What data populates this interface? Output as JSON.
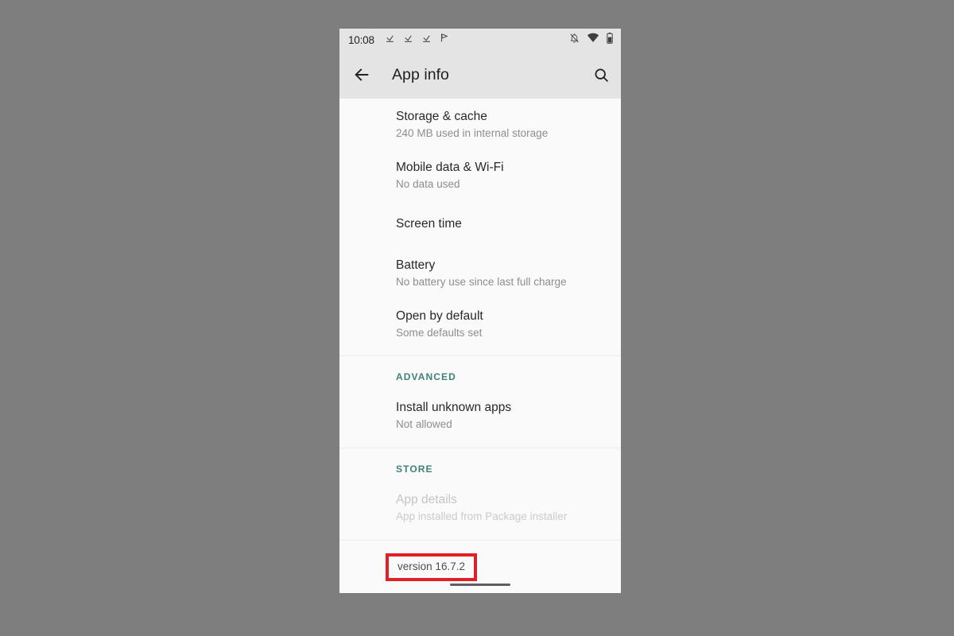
{
  "theme": {
    "page_background": "#7e7e7e",
    "screen_background": "#fafafa",
    "app_bar_background": "#e4e4e4",
    "section_header_color": "#3f8177",
    "highlight_color": "#e01f26",
    "primary_text_color": "#26282a",
    "secondary_text_color": "#8b8e91",
    "disabled_text_color": "#c3c5c7"
  },
  "status_bar": {
    "time": "10:08",
    "left_icons": [
      "download-arrow-icon",
      "download-arrow-icon",
      "download-arrow-icon",
      "flag-outline-icon"
    ],
    "right_icons": [
      "notifications-off-icon",
      "wifi-icon",
      "battery-icon"
    ]
  },
  "app_bar": {
    "back_icon": "back-arrow-icon",
    "title": "App info",
    "search_icon": "search-icon"
  },
  "sections": [
    {
      "header": null,
      "items": [
        {
          "primary": "Storage & cache",
          "secondary": "240 MB used in internal storage",
          "disabled": false
        },
        {
          "primary": "Mobile data & Wi-Fi",
          "secondary": "No data used",
          "disabled": false
        },
        {
          "primary": "Screen time",
          "secondary": null,
          "disabled": false
        },
        {
          "primary": "Battery",
          "secondary": "No battery use since last full charge",
          "disabled": false
        },
        {
          "primary": "Open by default",
          "secondary": "Some defaults set",
          "disabled": false
        }
      ]
    },
    {
      "header": "ADVANCED",
      "items": [
        {
          "primary": "Install unknown apps",
          "secondary": "Not allowed",
          "disabled": false
        }
      ]
    },
    {
      "header": "STORE",
      "items": [
        {
          "primary": "App details",
          "secondary": "App installed from Package installer",
          "disabled": true
        }
      ]
    }
  ],
  "version_row": {
    "text": "version 16.7.2",
    "highlighted": true
  },
  "home_indicator": "home-indicator-bar"
}
